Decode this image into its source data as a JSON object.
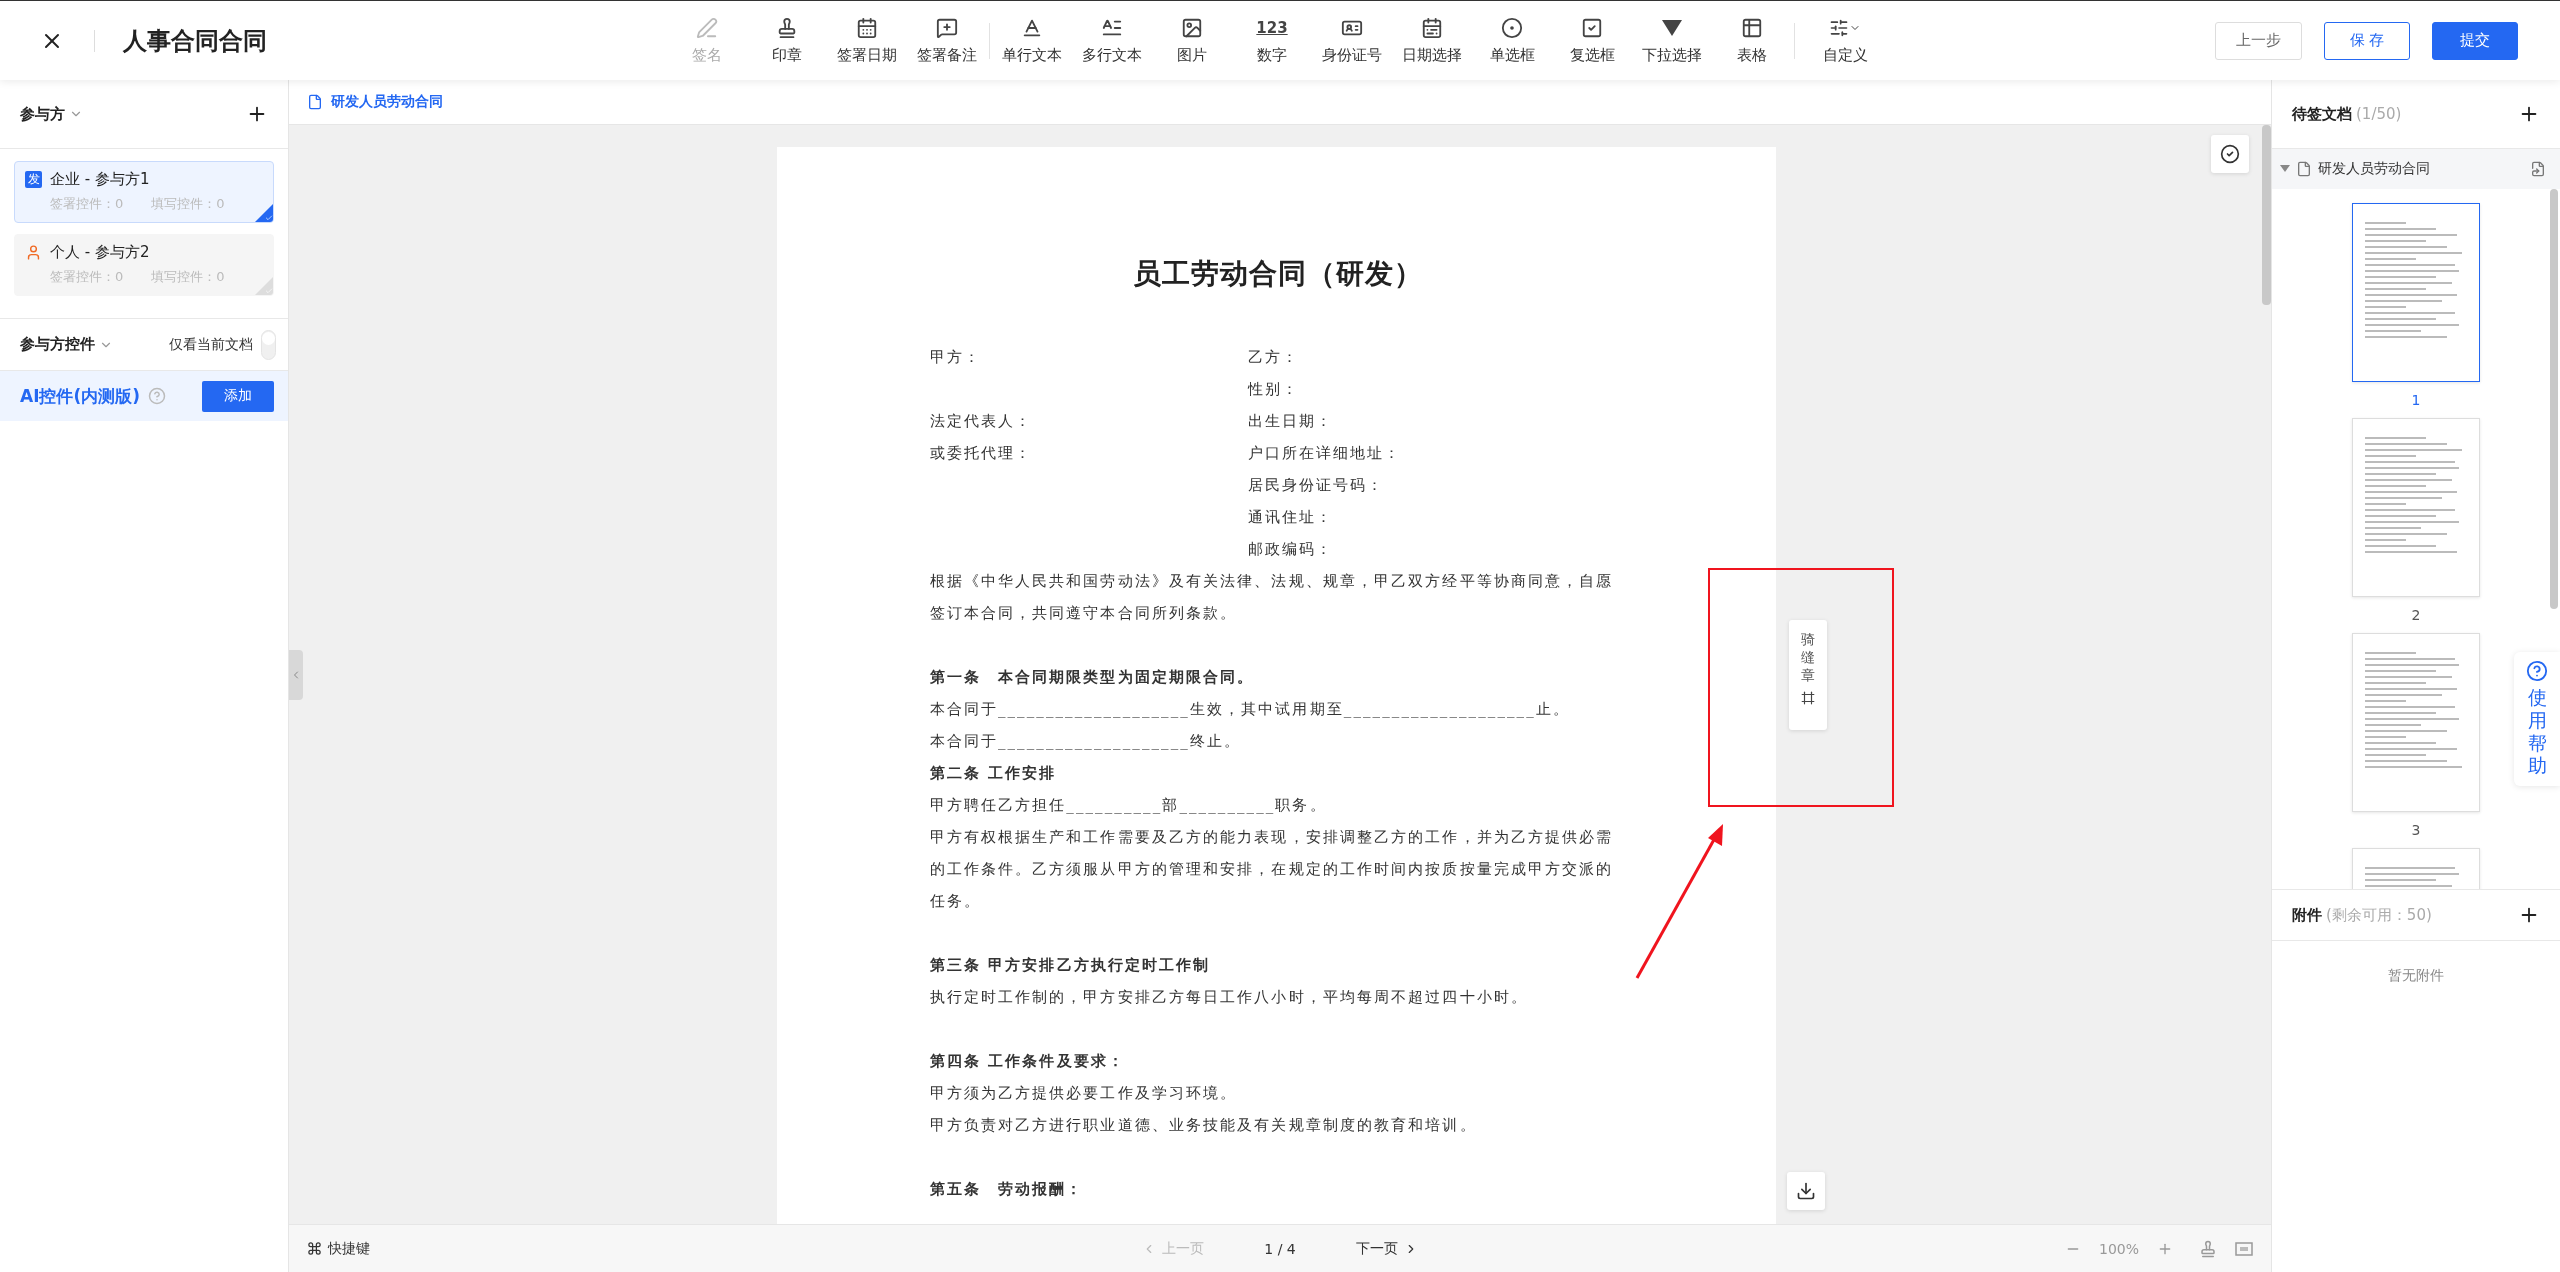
{
  "window": {
    "title": "人事合同合同"
  },
  "toolbar": {
    "tools": [
      {
        "label": "签名",
        "disabled": true
      },
      {
        "label": "印章",
        "disabled": false
      },
      {
        "label": "签署日期",
        "disabled": false
      },
      {
        "label": "签署备注",
        "disabled": false
      },
      {
        "label": "单行文本",
        "disabled": false,
        "group_start": true
      },
      {
        "label": "多行文本",
        "disabled": false
      },
      {
        "label": "图片",
        "disabled": false
      },
      {
        "label": "数字",
        "disabled": false,
        "icon_text": "123"
      },
      {
        "label": "身份证号",
        "disabled": false
      },
      {
        "label": "日期选择",
        "disabled": false
      },
      {
        "label": "单选框",
        "disabled": false
      },
      {
        "label": "复选框",
        "disabled": false
      },
      {
        "label": "下拉选择",
        "disabled": false
      },
      {
        "label": "表格",
        "disabled": false
      }
    ],
    "custom": "自定义"
  },
  "buttons": [
    {
      "label": "上一步",
      "kind": "secondary"
    },
    {
      "label": "保 存",
      "kind": "outline"
    },
    {
      "label": "提交",
      "kind": "primary"
    }
  ],
  "participants": {
    "title": "参与方",
    "parties": [
      {
        "kind": "company",
        "badge": "发",
        "name": "企业 - 参与方1",
        "sign_count": "签署控件：0",
        "fill_count": "填写控件：0",
        "selected": true
      },
      {
        "kind": "person",
        "name": "个人 - 参与方2",
        "sign_count": "签署控件：0",
        "fill_count": "填写控件：0",
        "selected": false
      }
    ]
  },
  "controls": {
    "title": "参与方控件",
    "toggle_label": "仅看当前文档",
    "on": false
  },
  "ai": {
    "title": "AI控件(内测版)",
    "button": "添加"
  },
  "doc_tab": "研发人员劳动合同",
  "document": {
    "title": "员工劳动合同（研发）",
    "party_rows": [
      {
        "left": "甲方：",
        "right": "乙方："
      },
      {
        "right": "性别："
      },
      {
        "left": "法定代表人：",
        "right": "出生日期："
      },
      {
        "left": "或委托代理：",
        "right": "户口所在详细地址："
      },
      {
        "right": "居民身份证号码："
      },
      {
        "right": "通讯住址："
      },
      {
        "right": "邮政编码："
      }
    ],
    "sections": [
      {
        "blocks": [
          {
            "kind": "text",
            "text": "根据《中华人民共和国劳动法》及有关法律、法规、规章，甲乙双方经平等协商同意，自愿签订本合同，共同遵守本合同所列条款。"
          }
        ]
      },
      {
        "blocks": [
          {
            "kind": "heading",
            "text": "第一条　本合同期限类型为固定期限合同。"
          },
          {
            "kind": "text",
            "text": "本合同于____________________生效，其中试用期至____________________止。"
          },
          {
            "kind": "text",
            "text": "本合同于____________________终止。"
          },
          {
            "kind": "heading",
            "text": "第二条 工作安排"
          },
          {
            "kind": "text",
            "text": "甲方聘任乙方担任__________部__________职务。"
          },
          {
            "kind": "text",
            "text": "甲方有权根据生产和工作需要及乙方的能力表现，安排调整乙方的工作，并为乙方提供必需的工作条件。乙方须服从甲方的管理和安排，在规定的工作时间内按质按量完成甲方交派的任务。"
          }
        ]
      },
      {
        "blocks": [
          {
            "kind": "heading",
            "text": "第三条 甲方安排乙方执行定时工作制"
          },
          {
            "kind": "text",
            "text": "执行定时工作制的，甲方安排乙方每日工作八小时，平均每周不超过四十小时。"
          }
        ]
      },
      {
        "blocks": [
          {
            "kind": "heading",
            "text": "第四条 工作条件及要求："
          },
          {
            "kind": "text",
            "text": "甲方须为乙方提供必要工作及学习环境。"
          },
          {
            "kind": "text",
            "text": "甲方负责对乙方进行职业道德、业务技能及有关规章制度的教育和培训。"
          }
        ]
      },
      {
        "blocks": [
          {
            "kind": "heading",
            "text": "第五条　劳动报酬："
          }
        ]
      }
    ]
  },
  "seam_seal": "骑缝章",
  "pending": {
    "title": "待签文档",
    "count": "(1/50)",
    "file": "研发人员劳动合同",
    "pages": [
      {
        "label": "1",
        "selected": true
      },
      {
        "label": "2",
        "selected": false
      },
      {
        "label": "3",
        "selected": false
      }
    ]
  },
  "attachments": {
    "title": "附件",
    "remaining": "(剩余可用：50)",
    "empty": "暂无附件"
  },
  "help": "使用帮助",
  "footer": {
    "shortcut": "快捷键",
    "prev": "上一页",
    "prev_disabled": true,
    "page": "1 / 4",
    "next": "下一页",
    "zoom": "100%"
  }
}
